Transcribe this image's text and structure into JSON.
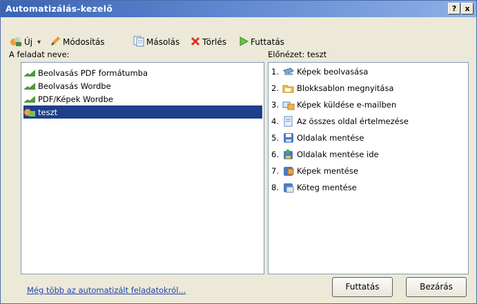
{
  "window": {
    "title": "Automatizálás-kezelő",
    "help_label": "?",
    "close_label": "x"
  },
  "toolbar": {
    "new_label": "Új",
    "dropdown_label": "▾",
    "edit_label": "Módosítás",
    "copy_label": "Másolás",
    "delete_label": "Törlés",
    "run_label": "Futtatás"
  },
  "tasks": {
    "header": "A feladat neve:",
    "items": [
      {
        "label": "Beolvasás PDF formátumba",
        "selected": false
      },
      {
        "label": "Beolvasás Wordbe",
        "selected": false
      },
      {
        "label": "PDF/Képek Wordbe",
        "selected": false
      },
      {
        "label": "teszt",
        "selected": true
      }
    ]
  },
  "preview": {
    "header": "Előnézet: teszt",
    "steps": [
      {
        "num": "1.",
        "label": "Képek beolvasása",
        "icon": "scanner-icon"
      },
      {
        "num": "2.",
        "label": "Blokksablon megnyitása",
        "icon": "folder-open-icon"
      },
      {
        "num": "3.",
        "label": "Képek küldése e-mailben",
        "icon": "email-icon"
      },
      {
        "num": "4.",
        "label": "Az összes oldal értelmezése",
        "icon": "document-icon"
      },
      {
        "num": "5.",
        "label": "Oldalak mentése",
        "icon": "save-icon"
      },
      {
        "num": "6.",
        "label": "Oldalak mentése ide",
        "icon": "save-to-icon"
      },
      {
        "num": "7.",
        "label": "Képek mentése",
        "icon": "save-images-icon"
      },
      {
        "num": "8.",
        "label": "Köteg mentése",
        "icon": "save-batch-icon"
      }
    ]
  },
  "footer": {
    "more_link": "Még több az automatizált feladatokról...",
    "run_button": "Futtatás",
    "close_button": "Bezárás"
  },
  "colors": {
    "title_bar": "#3a64b4",
    "selection": "#1d3f8c",
    "link": "#2244aa"
  }
}
